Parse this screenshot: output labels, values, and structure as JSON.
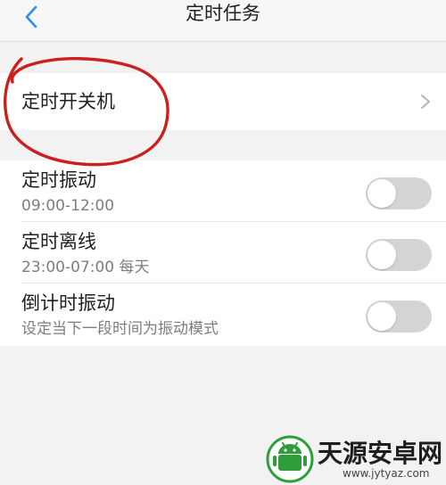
{
  "header": {
    "title": "定时任务",
    "back_icon": "chevron-left-icon"
  },
  "sections": {
    "power": {
      "label": "定时开关机",
      "chevron_icon": "chevron-right-icon"
    },
    "settings": [
      {
        "title": "定时振动",
        "subtitle": "09:00-12:00",
        "enabled": false
      },
      {
        "title": "定时离线",
        "subtitle": "23:00-07:00 每天",
        "enabled": false
      },
      {
        "title": "倒计时振动",
        "subtitle": "设定当下一段时间为振动模式",
        "enabled": false
      }
    ]
  },
  "watermark": {
    "name": "天源安卓网",
    "url": "www.jytyaz.com"
  },
  "colors": {
    "accent": "#2f8ee6",
    "annotation": "#cc2020",
    "toggle_off": "#d4d4d4",
    "watermark_green": "#2e9e3a"
  }
}
